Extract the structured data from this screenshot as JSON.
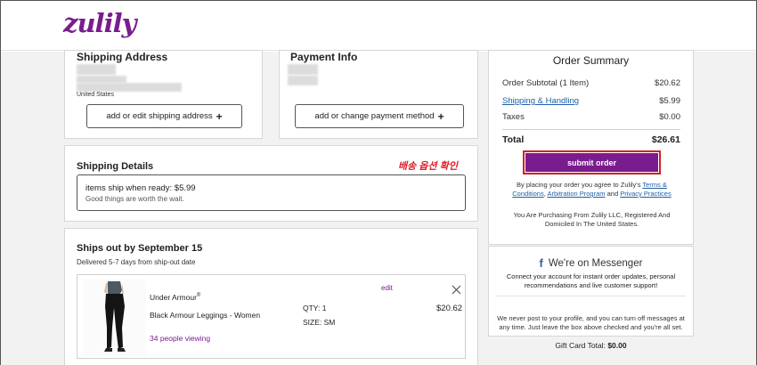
{
  "brand": {
    "logo": "zulily"
  },
  "shipping_address": {
    "title": "Shipping Address",
    "country": "United States",
    "button_label": "add or edit shipping address"
  },
  "payment_info": {
    "title": "Payment Info",
    "button_label": "add or change payment method"
  },
  "shipping_details": {
    "title": "Shipping Details",
    "annotation": "배송 옵션 확인",
    "option_label": "items ship when ready: $5.99",
    "option_note": "Good things are worth the wait."
  },
  "ships_out": {
    "title": "Ships out by September 15",
    "subtitle": "Delivered 5-7 days from ship-out date",
    "item": {
      "brand": "Under Armour",
      "brand_mark": "®",
      "name": "Black Armour Leggings - Women",
      "viewing": "34 people viewing",
      "edit": "edit",
      "qty": "QTY: 1",
      "size": "SIZE: SM",
      "price": "$20.62"
    }
  },
  "order_summary": {
    "title": "Order Summary",
    "rows": [
      {
        "label": "Order Subtotal (1 Item)",
        "value": "$20.62"
      },
      {
        "label": "Shipping & Handling",
        "value": "$5.99"
      },
      {
        "label": "Taxes",
        "value": "$0.00"
      }
    ],
    "total_label": "Total",
    "total_value": "$26.61",
    "submit_label": "submit order",
    "agree_text_1": "By placing your order you agree to Zulily's",
    "terms_link": "Terms & Conditions",
    "comma": ",",
    "arbitration_link": "Arbitration Program",
    "and_text": "and",
    "privacy_link": "Privacy Practices",
    "purchasing_text": "You Are Purchasing From Zulily LLC, Registered And Domiciled In The United States."
  },
  "messenger": {
    "title": "We're on Messenger",
    "subtitle": "Connect your account for instant order updates, personal recommendations and live customer support!",
    "note": "We never post to your profile, and you can turn off messages at any time. Just leave the box above checked and you're all set."
  },
  "gift_card": {
    "label": "Gift Card Total:",
    "value": "$0.00"
  },
  "colors": {
    "brand_purple": "#7a1c8e",
    "submit_border": "#d0202a",
    "link_blue": "#1f5fa8",
    "annotation_red": "#e0202a"
  }
}
